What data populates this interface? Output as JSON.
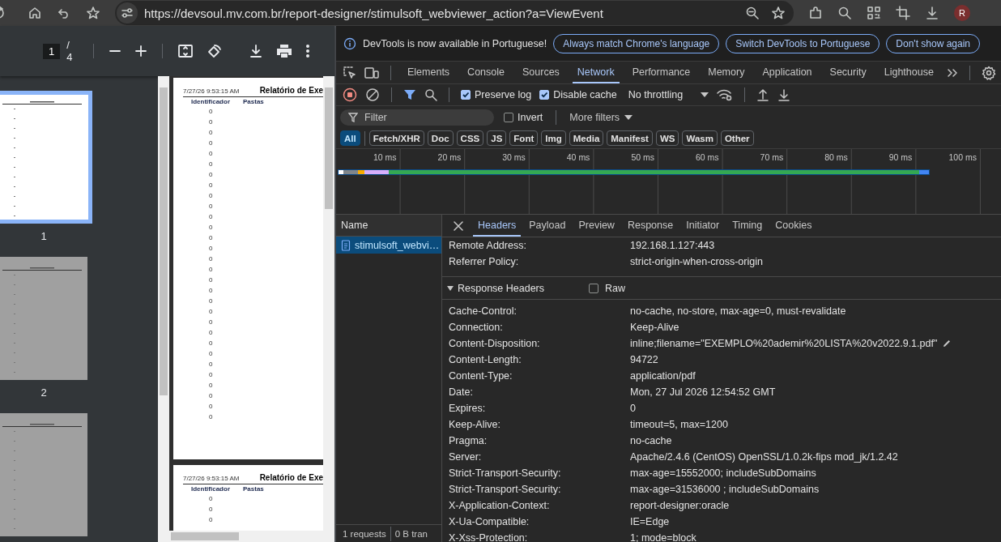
{
  "browser_toolbar": {
    "url": "https://devsoul.mv.com.br/report-designer/stimulsoft_webviewer_action?a=ViewEvent",
    "avatar": "R"
  },
  "pdf_viewer": {
    "page_input": "1",
    "page_total": "/ 4",
    "thumbnails": [
      {
        "label": "1",
        "selected": true
      },
      {
        "label": "2",
        "selected": false
      },
      {
        "selected": false
      }
    ],
    "pages": [
      {
        "timestamp": "7/27/26 9:53:15 AM",
        "title": "Relatório de Exe",
        "columns": [
          "Identificador",
          "Pastas"
        ],
        "rows": [
          "0",
          "0",
          "0",
          "0",
          "0",
          "0",
          "0",
          "0",
          "0",
          "0",
          "0",
          "0",
          "0",
          "0",
          "0",
          "0",
          "0",
          "0",
          "0",
          "0",
          "0",
          "0",
          "0",
          "0",
          "0",
          "0",
          "0",
          "0",
          "0",
          "0"
        ]
      },
      {
        "timestamp": "7/27/26 9:53:15 AM",
        "title": "Relatório de Exe",
        "columns": [
          "Identificador",
          "Pastas"
        ],
        "rows": [
          "0",
          "0",
          "0"
        ]
      }
    ]
  },
  "devtools": {
    "infobar": {
      "message": "DevTools is now available in Portuguese!",
      "buttons": [
        "Always match Chrome's language",
        "Switch DevTools to Portuguese",
        "Don't show again"
      ]
    },
    "tabs": [
      {
        "label": "Elements",
        "selected": false
      },
      {
        "label": "Console",
        "selected": false
      },
      {
        "label": "Sources",
        "selected": false
      },
      {
        "label": "Network",
        "selected": true
      },
      {
        "label": "Performance",
        "selected": false
      },
      {
        "label": "Memory",
        "selected": false
      },
      {
        "label": "Application",
        "selected": false
      },
      {
        "label": "Security",
        "selected": false
      },
      {
        "label": "Lighthouse",
        "selected": false
      }
    ],
    "network_toolbar": {
      "recording": true,
      "checkboxes": [
        {
          "label": "Preserve log",
          "checked": true
        },
        {
          "label": "Disable cache",
          "checked": true
        }
      ],
      "throttling": "No throttling"
    },
    "filter_bar": {
      "placeholder": "Filter",
      "invert": {
        "label": "Invert",
        "checked": false
      },
      "more_filters": "More filters"
    },
    "type_filters": [
      {
        "label": "All",
        "selected": true
      },
      {
        "label": "Fetch/XHR",
        "selected": false
      },
      {
        "label": "Doc",
        "selected": false
      },
      {
        "label": "CSS",
        "selected": false
      },
      {
        "label": "JS",
        "selected": false
      },
      {
        "label": "Font",
        "selected": false
      },
      {
        "label": "Img",
        "selected": false
      },
      {
        "label": "Media",
        "selected": false
      },
      {
        "label": "Manifest",
        "selected": false
      },
      {
        "label": "WS",
        "selected": false
      },
      {
        "label": "Wasm",
        "selected": false
      },
      {
        "label": "Other",
        "selected": false
      }
    ],
    "timeline": {
      "ticks": [
        "10 ms",
        "20 ms",
        "30 ms",
        "40 ms",
        "50 ms",
        "60 ms",
        "70 ms",
        "80 ms",
        "90 ms",
        "100 ms"
      ]
    },
    "requests": {
      "column": "Name",
      "rows": [
        {
          "name": "stimulsoft_webvi…",
          "selected": true
        }
      ],
      "status": [
        "1 requests",
        "0 B tran"
      ]
    },
    "details": {
      "tabs": [
        {
          "label": "Headers",
          "selected": true
        },
        {
          "label": "Payload",
          "selected": false
        },
        {
          "label": "Preview",
          "selected": false
        },
        {
          "label": "Response",
          "selected": false
        },
        {
          "label": "Initiator",
          "selected": false
        },
        {
          "label": "Timing",
          "selected": false
        },
        {
          "label": "Cookies",
          "selected": false
        }
      ],
      "general": [
        {
          "name": "Remote Address:",
          "value": "192.168.1.127:443"
        },
        {
          "name": "Referrer Policy:",
          "value": "strict-origin-when-cross-origin"
        }
      ],
      "response_headers": {
        "title": "Response Headers",
        "expanded": true,
        "raw": {
          "label": "Raw",
          "checked": false
        },
        "rows": [
          {
            "name": "Cache-Control:",
            "value": "no-cache, no-store, max-age=0, must-revalidate",
            "editable": false
          },
          {
            "name": "Connection:",
            "value": "Keep-Alive",
            "editable": false
          },
          {
            "name": "Content-Disposition:",
            "value": "inline;filename=\"EXEMPLO%20ademir%20LISTA%20v2022.9.1.pdf\"",
            "editable": true
          },
          {
            "name": "Content-Length:",
            "value": "94722",
            "editable": false
          },
          {
            "name": "Content-Type:",
            "value": "application/pdf",
            "editable": false
          },
          {
            "name": "Date:",
            "value": "Mon, 27 Jul 2026 12:54:52 GMT",
            "editable": false
          },
          {
            "name": "Expires:",
            "value": "0",
            "editable": false
          },
          {
            "name": "Keep-Alive:",
            "value": "timeout=5, max=1200",
            "editable": false
          },
          {
            "name": "Pragma:",
            "value": "no-cache",
            "editable": false
          },
          {
            "name": "Server:",
            "value": "Apache/2.4.6 (CentOS) OpenSSL/1.0.2k-fips mod_jk/1.2.42",
            "editable": false
          },
          {
            "name": "Strict-Transport-Security:",
            "value": "max-age=15552000; includeSubDomains",
            "editable": false
          },
          {
            "name": "Strict-Transport-Security:",
            "value": "max-age=31536000 ; includeSubDomains",
            "editable": false
          },
          {
            "name": "X-Application-Context:",
            "value": "report-designer:oracle",
            "editable": false
          },
          {
            "name": "X-Ua-Compatible:",
            "value": "IE=Edge",
            "editable": false
          },
          {
            "name": "X-Xss-Protection:",
            "value": "1; mode=block",
            "editable": false
          }
        ]
      }
    }
  }
}
